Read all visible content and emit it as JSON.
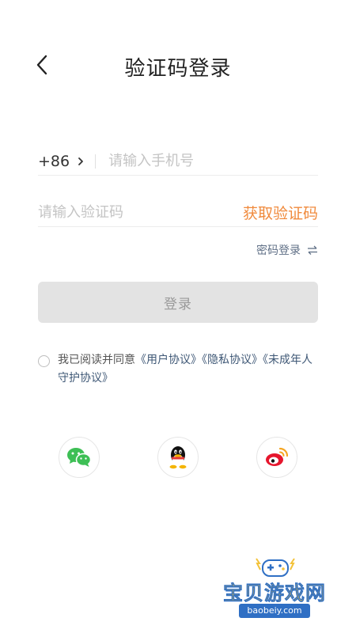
{
  "header": {
    "title": "验证码登录",
    "back_icon": "chevron-left-icon"
  },
  "phone": {
    "country_code": "+86",
    "placeholder": "请输入手机号",
    "value": ""
  },
  "verification": {
    "placeholder": "请输入验证码",
    "value": "",
    "get_code_label": "获取验证码"
  },
  "password_login": {
    "label": "密码登录",
    "icon": "swap-arrows-icon"
  },
  "login_button": {
    "label": "登录"
  },
  "agreement": {
    "prefix": "我已阅读并同意",
    "user_agreement": "《用户协议》",
    "privacy_agreement": "《隐私协议》",
    "minor_agreement": "《未成年人守护协议》",
    "checked": false
  },
  "social_login": [
    {
      "name": "wechat",
      "icon": "wechat-icon"
    },
    {
      "name": "qq",
      "icon": "qq-icon"
    },
    {
      "name": "weibo",
      "icon": "weibo-icon"
    }
  ],
  "watermark": {
    "title": "宝贝游戏网",
    "url": "baobeiy.com"
  },
  "colors": {
    "accent": "#f08a3c",
    "link": "#3f5876",
    "button_disabled_bg": "#e3e3e3",
    "button_disabled_text": "#9a9a9a",
    "wechat": "#3dbf55",
    "weibo": "#e6162d",
    "watermark_yellow": "#f3c23a",
    "watermark_blue": "#2f6fc4"
  }
}
